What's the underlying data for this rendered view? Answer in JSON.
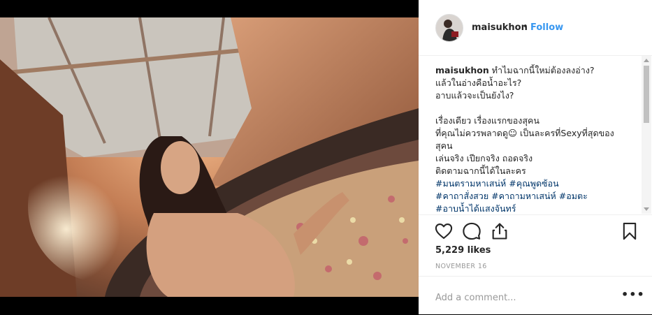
{
  "post": {
    "username": "maisukhon",
    "separator": "•",
    "follow_label": "Follow",
    "caption_lines": [
      "ทำไมฉากนี้ใหม่ต้องลงอ่าง?",
      "แล้วในอ่างคือน้ำอะไร?",
      "อาบแล้วจะเป็นยังไง?",
      "",
      "เรื่องเดียว เรื่องแรกของสุคน",
      "ที่คุณไม่ควรพลาดดู☺ เป็นละครที่Sexyที่สุดของ",
      "สุคน",
      "เล่นจริง เปียกจริง ถอดจริง",
      "ติดตามฉากนี้ได้ในละคร"
    ],
    "hashtag_lines": [
      [
        "#มนตรามหาเสน่ห์",
        "#คุณพูดซ้อน"
      ],
      [
        "#คาถาสั่งสวย",
        "#คาถามหาเสน่ห์",
        "#อมตะ"
      ],
      [
        "#อาบน้ำได้แสงจันทร์"
      ]
    ],
    "likes": "5,229 likes",
    "date": "NOVEMBER 16",
    "comment_placeholder": "Add a comment...",
    "more_label": "•••"
  },
  "icons": [
    "heart-icon",
    "comment-icon",
    "share-icon",
    "bookmark-icon"
  ],
  "colors": {
    "link": "#3897f0",
    "hashtag": "#003569",
    "text": "#262626",
    "muted": "#999999"
  }
}
